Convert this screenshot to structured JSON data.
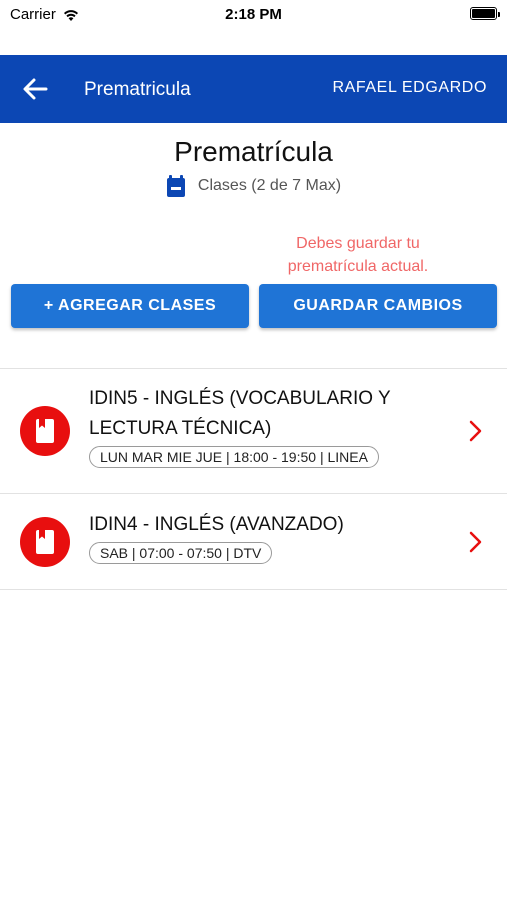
{
  "status_bar": {
    "carrier": "Carrier",
    "time": "2:18 PM"
  },
  "app_bar": {
    "title": "Prematricula",
    "user": "RAFAEL EDGARDO"
  },
  "header": {
    "title": "Prematrícula",
    "classes_count": "Clases (2 de 7 Max)"
  },
  "warning": "Debes guardar tu prematrícula actual.",
  "buttons": {
    "add": "+ AGREGAR CLASES",
    "save": "GUARDAR CAMBIOS"
  },
  "classes": [
    {
      "name": "IDIN5 - INGLÉS (VOCABULARIO Y LECTURA TÉCNICA)",
      "schedule": "LUN MAR MIE JUE | 18:00 - 19:50 | LINEA"
    },
    {
      "name": "IDIN4 - INGLÉS (AVANZADO)",
      "schedule": "SAB | 07:00 - 07:50 | DTV"
    }
  ],
  "colors": {
    "app_bar": "#0c47b4",
    "button": "#1f74d6",
    "warning": "#f06767",
    "class_icon": "#e80f0f",
    "chevron": "#e80f0f"
  }
}
